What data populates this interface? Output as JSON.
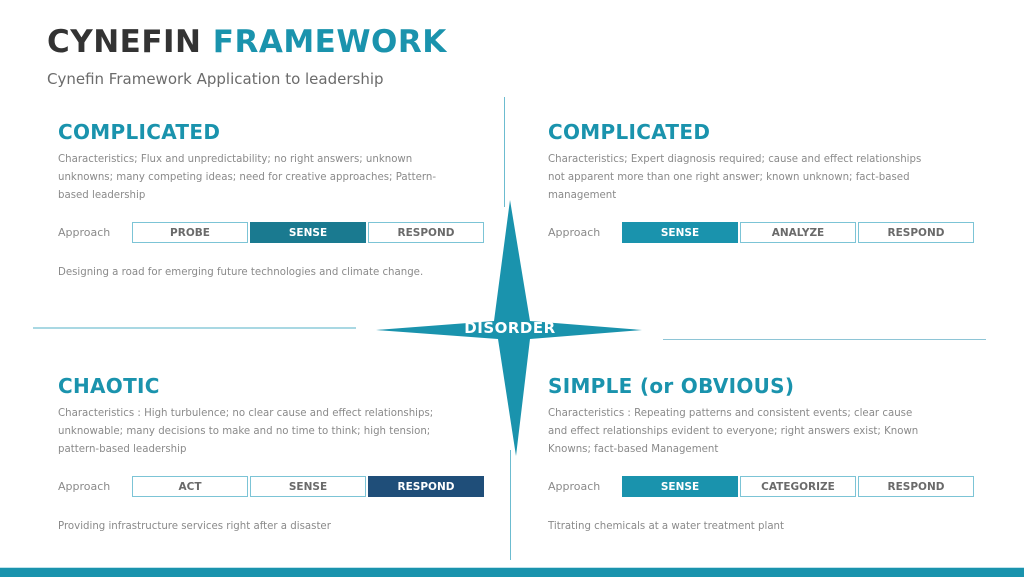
{
  "header": {
    "title_part1": "CYNEFIN",
    "title_part2": "FRAMEWORK",
    "subtitle": "Cynefin Framework Application to leadership"
  },
  "colors": {
    "accent": "#1a93ad",
    "dark_teal": "#1a7a90",
    "navy": "#1f4e79",
    "title_dark": "#333333",
    "text_gray": "#8a8a8a"
  },
  "center": {
    "label": "DISORDER",
    "icon": "four-point-star-icon"
  },
  "quadrants": [
    {
      "title": "COMPLICATED",
      "description": "Characteristics; Flux and unpredictability;  no right answers; unknown unknowns; many competing ideas; need for creative approaches; Pattern-based leadership",
      "approach_label": "Approach",
      "steps": [
        {
          "label": "PROBE",
          "active": false
        },
        {
          "label": "SENSE",
          "active": true
        },
        {
          "label": "RESPOND",
          "active": false
        }
      ],
      "example": "Designing  a road for emerging future technologies and climate change."
    },
    {
      "title": "COMPLICATED",
      "description": "Characteristics; Expert diagnosis required; cause and effect relationships not apparent more than one right answer; known unknown; fact-based management",
      "approach_label": "Approach",
      "steps": [
        {
          "label": "SENSE",
          "active": true
        },
        {
          "label": "ANALYZE",
          "active": false
        },
        {
          "label": "RESPOND",
          "active": false
        }
      ],
      "example": ""
    },
    {
      "title": "CHAOTIC",
      "description": "Characteristics : High turbulence; no clear cause and effect relationships; unknowable; many decisions to make and no time to think; high tension; pattern-based leadership",
      "approach_label": "Approach",
      "steps": [
        {
          "label": "ACT",
          "active": false
        },
        {
          "label": "SENSE",
          "active": false
        },
        {
          "label": "RESPOND",
          "active": true
        }
      ],
      "example": "Providing infrastructure services right after a disaster"
    },
    {
      "title": "SIMPLE (or OBVIOUS)",
      "description": "Characteristics : Repeating patterns and consistent events; clear cause and effect relationships evident to everyone; right answers exist; Known Knowns; fact-based Management",
      "approach_label": "Approach",
      "steps": [
        {
          "label": "SENSE",
          "active": true
        },
        {
          "label": "CATEGORIZE",
          "active": false
        },
        {
          "label": "RESPOND",
          "active": false
        }
      ],
      "example": "Titrating chemicals at a water treatment plant"
    }
  ]
}
